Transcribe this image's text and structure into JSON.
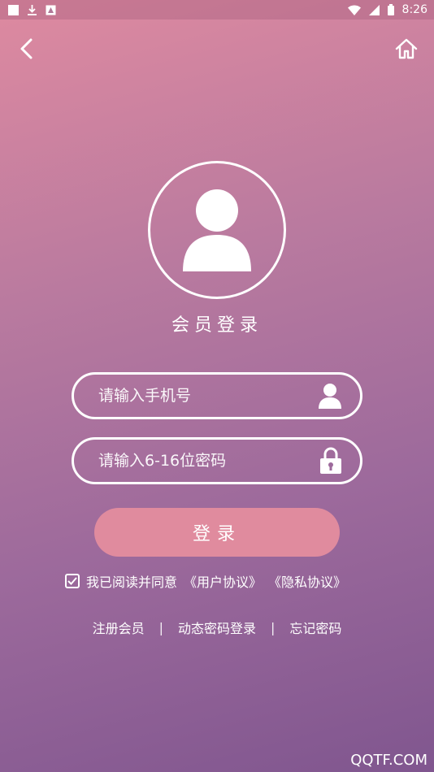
{
  "status_bar": {
    "time": "8:26"
  },
  "header": {
    "back_icon": "back-chevron-icon",
    "home_icon": "home-icon"
  },
  "profile": {
    "title": "会员登录"
  },
  "form": {
    "phone_placeholder": "请输入手机号",
    "password_placeholder": "请输入6-16位密码",
    "login_label": "登录"
  },
  "agreement": {
    "checked": true,
    "prefix": "我已阅读并同意",
    "user_agreement": "《用户协议》",
    "privacy_agreement": "《隐私协议》"
  },
  "links": {
    "register": "注册会员",
    "separator": "|",
    "dynamic_login": "动态密码登录",
    "forgot_password": "忘记密码"
  },
  "watermark": "QQTF.COM"
}
